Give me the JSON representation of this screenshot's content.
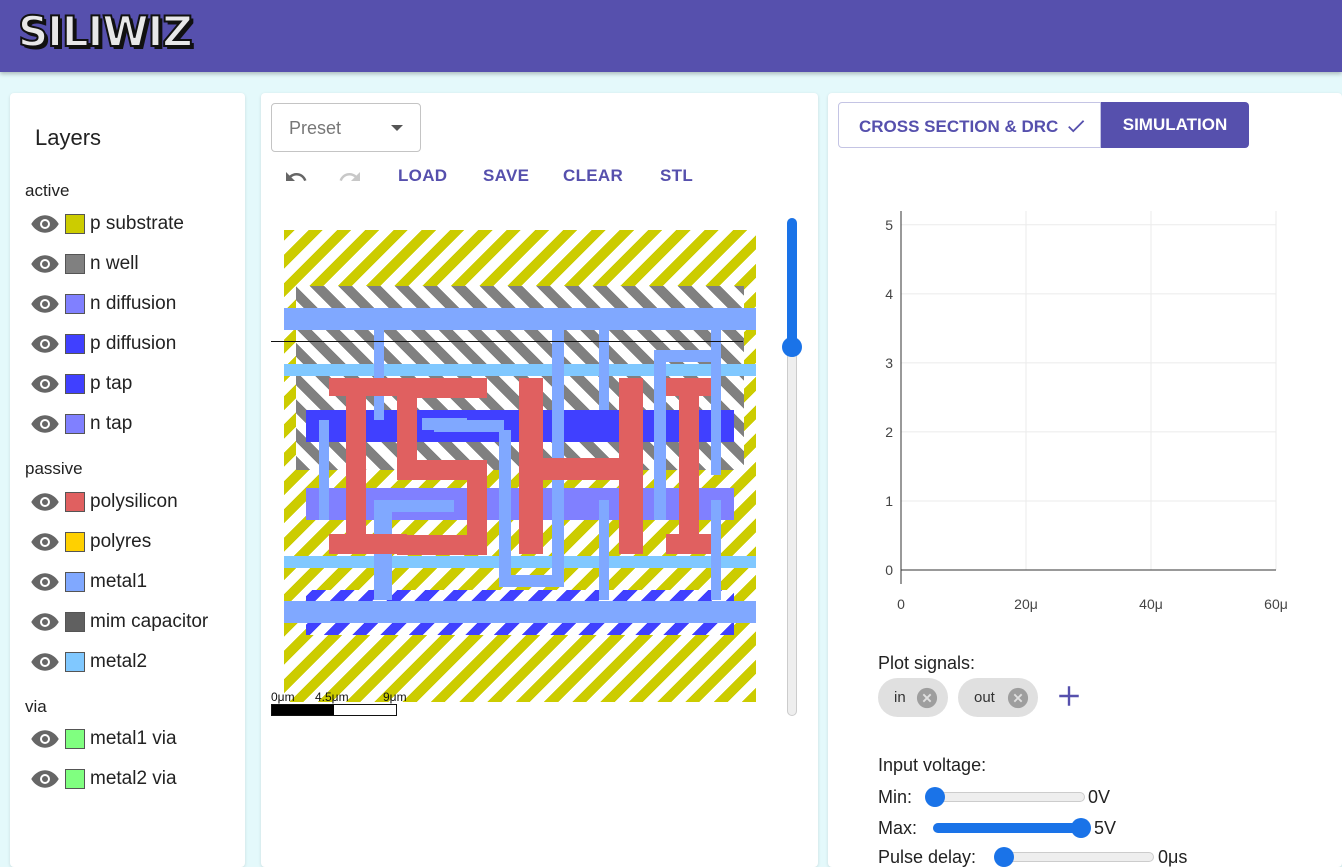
{
  "app": {
    "title": "SILIWIZ"
  },
  "layers_panel": {
    "title": "Layers",
    "groups": [
      {
        "name": "active",
        "items": [
          {
            "label": "p substrate",
            "color": "#cccc00"
          },
          {
            "label": "n well",
            "color": "#808080"
          },
          {
            "label": "n diffusion",
            "color": "#8080ff"
          },
          {
            "label": "p diffusion",
            "color": "#4040ff"
          },
          {
            "label": "p tap",
            "color": "#4040ff"
          },
          {
            "label": "n tap",
            "color": "#8080ff"
          }
        ]
      },
      {
        "name": "passive",
        "items": [
          {
            "label": "polysilicon",
            "color": "#e06060"
          },
          {
            "label": "polyres",
            "color": "#ffd000"
          },
          {
            "label": "metal1",
            "color": "#80a8ff"
          },
          {
            "label": "mim capacitor",
            "color": "#606060"
          },
          {
            "label": "metal2",
            "color": "#80c8ff"
          }
        ]
      },
      {
        "name": "via",
        "items": [
          {
            "label": "metal1 via",
            "color": "#80ff80"
          },
          {
            "label": "metal2 via",
            "color": "#80ff80"
          }
        ]
      }
    ]
  },
  "layout_panel": {
    "preset": {
      "label": "Preset"
    },
    "toolbar": {
      "undo_icon": "undo-icon",
      "redo_icon": "redo-icon",
      "load": "LOAD",
      "save": "SAVE",
      "clear": "CLEAR",
      "stl": "STL"
    },
    "scale": {
      "labels": [
        "0μm",
        "4.5μm",
        "9μm"
      ]
    },
    "cross_section_slider": {
      "value_fraction": 0.26
    }
  },
  "sim_panel": {
    "tabs": {
      "cross_section": "CROSS SECTION & DRC",
      "simulation": "SIMULATION",
      "active": "simulation"
    },
    "chart_data": {
      "type": "line",
      "title": "",
      "xlabel": "",
      "ylabel": "",
      "x_ticks": [
        "0",
        "20μ",
        "40μ",
        "60μ"
      ],
      "y_ticks": [
        "0",
        "1",
        "2",
        "3",
        "4",
        "5"
      ],
      "xlim": [
        0,
        60
      ],
      "ylim": [
        0,
        5.2
      ],
      "grid": true,
      "series": []
    },
    "plot_signals": {
      "label": "Plot signals:",
      "signals": [
        "in",
        "out"
      ]
    },
    "input_voltage": {
      "label": "Input voltage:",
      "min": {
        "label": "Min:",
        "value": "0V",
        "fraction": 0.0
      },
      "max": {
        "label": "Max:",
        "value": "5V",
        "fraction": 1.0
      },
      "pulse_delay": {
        "label": "Pulse delay:",
        "value": "0μs",
        "fraction": 0.0
      }
    }
  }
}
